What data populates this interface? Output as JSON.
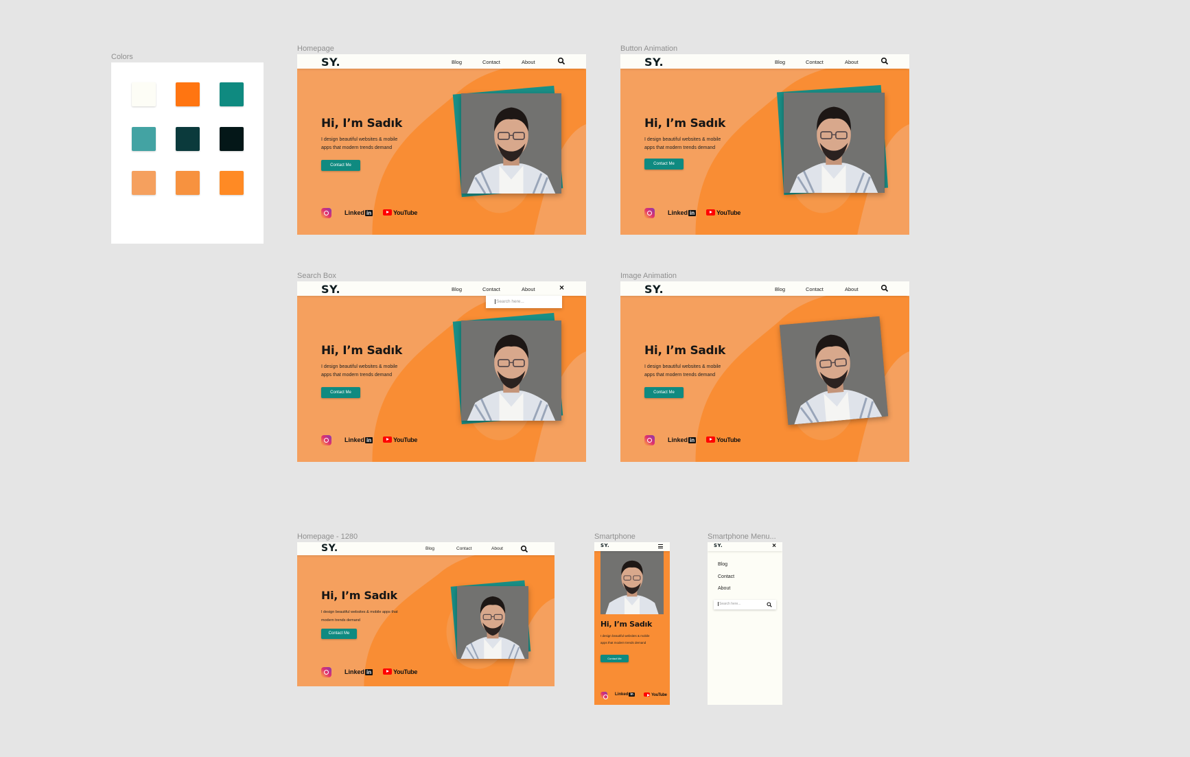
{
  "frames": {
    "colors": "Colors",
    "homepage": "Homepage",
    "button_animation": "Button Animation",
    "search_box": "Search Box",
    "image_animation": "Image Animation",
    "homepage_1280": "Homepage - 1280",
    "smartphone": "Smartphone",
    "smartphone_menu": "Smartphone Menu..."
  },
  "palette": [
    "#fdfdf6",
    "#ff7511",
    "#0f8a80",
    "#43a3a3",
    "#0b3a3c",
    "#041718",
    "#f5a05e",
    "#f7923f",
    "#ff8a24"
  ],
  "site": {
    "logo": "SY.",
    "nav": {
      "blog": "Blog",
      "contact": "Contact",
      "about": "About"
    },
    "hero": {
      "title": "Hi, I’m Sadık",
      "subtitle": "I design beautiful websites & mobile\napps that modern trends demand",
      "subtitle_1280": "I design beautiful websites & mobile apps that\nmodern trends demand",
      "cta": "Contact Me"
    },
    "social": {
      "linkedin": "Linked",
      "linkedin_mark": "in",
      "youtube": "YouTube"
    },
    "search_placeholder": "Search here..."
  },
  "colors_theme": {
    "orange": "#f5a05e",
    "orange_deep": "#f98d34",
    "teal": "#0f8a80",
    "navbar": "#fdfdf8"
  }
}
